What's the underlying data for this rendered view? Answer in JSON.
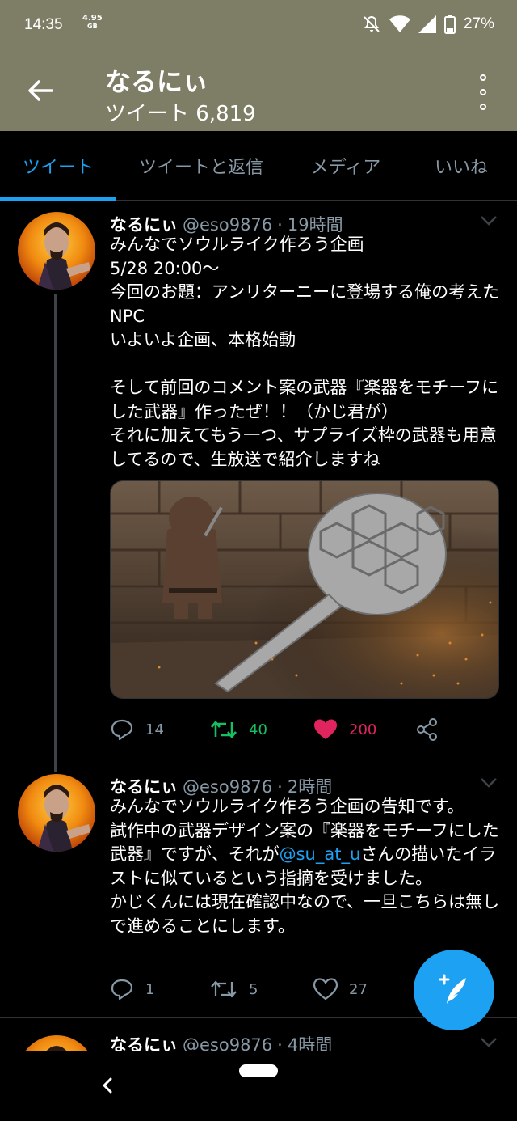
{
  "status_bar": {
    "time": "14:35",
    "speed_value": "4.95",
    "speed_unit": "GB",
    "battery": "27%"
  },
  "header": {
    "title": "なるにぃ",
    "subtitle": "ツイート 6,819"
  },
  "tabs": [
    {
      "label": "ツイート",
      "active": true
    },
    {
      "label": "ツイートと返信",
      "active": false
    },
    {
      "label": "メディア",
      "active": false
    },
    {
      "label": "いいね",
      "active": false
    }
  ],
  "tweets": [
    {
      "name": "なるにぃ",
      "handle": "@eso9876",
      "dot": "·",
      "time": "19時間",
      "text": "みんなでソウルライク作ろう企画\n5/28 20:00〜\n今回のお題：アンリターニーに登場する俺の考えたNPC\nいよいよ企画、本格始動\n\nそして前回のコメント案の武器『楽器をモチーフにした武器』作ったぜ！！（かじ君が）\nそれに加えてもう一つ、サプライズ枠の武器も用意してるので、生放送で紹介しますね",
      "replies": "14",
      "retweets": "40",
      "likes": "200"
    },
    {
      "name": "なるにぃ",
      "handle": "@eso9876",
      "dot": "·",
      "time": "2時間",
      "text_before": "みんなでソウルライク作ろう企画の告知です。\n試作中の武器デザイン案の『楽器をモチーフにした武器』ですが、それが",
      "mention": "@su_at_u",
      "text_after": "さんの描いたイラストに似ているという指摘を受けました。\nかじくんには現在確認中なので、一旦こちらは無しで進めることにします。",
      "replies": "1",
      "retweets": "5",
      "likes": "27"
    },
    {
      "name": "なるにぃ",
      "handle": "@eso9876",
      "dot": "·",
      "time": "4時間"
    }
  ],
  "colors": {
    "header_bg": "#7e7e67",
    "accent": "#1da1f2",
    "retweet": "#17bf63",
    "like": "#e0245e",
    "muted": "#8899a6"
  },
  "icons": [
    "back-arrow-icon",
    "more-vert-icon",
    "reply-icon",
    "retweet-icon",
    "heart-icon",
    "share-icon",
    "compose-icon",
    "chevron-down-icon",
    "wifi-icon",
    "signal-icon",
    "battery-icon",
    "mute-icon"
  ]
}
